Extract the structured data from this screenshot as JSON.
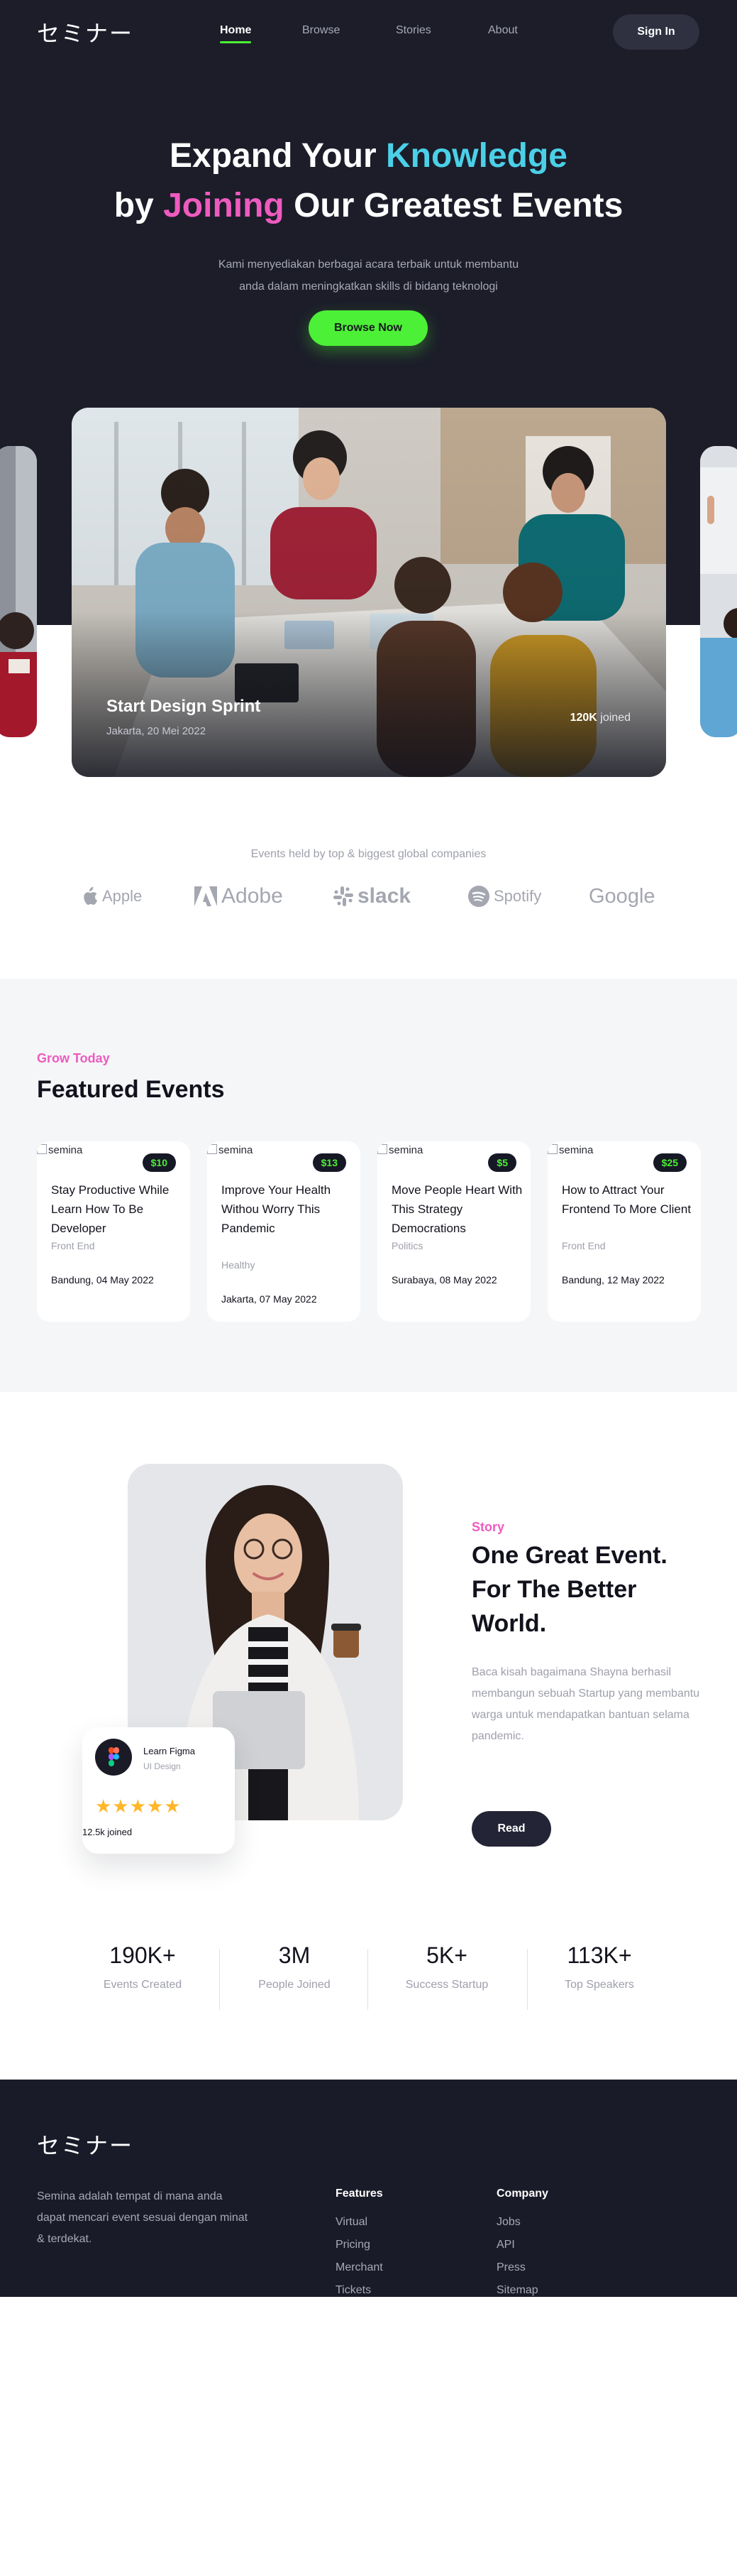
{
  "nav": {
    "logo": "セミナー",
    "links": [
      "Home",
      "Browse",
      "Stories",
      "About"
    ],
    "signin": "Sign In",
    "accent": "#4cf036"
  },
  "hero": {
    "line1_a": "Expand Your ",
    "line1_b": "Knowledge",
    "line2_a": "by ",
    "line2_b": "Joining",
    "line2_c": " Our Greatest Events",
    "sub1": "Kami menyediakan berbagai acara terbaik untuk membantu",
    "sub2": "anda dalam meningkatkan skills di bidang teknologi",
    "cta": "Browse Now",
    "card_title": "Start Design Sprint",
    "card_date": "Jakarta, 20 Mei 2022",
    "card_joined_num": "120K",
    "card_joined_word": " joined"
  },
  "companies": {
    "label": "Events held by top & biggest global companies",
    "names": [
      "Apple",
      "Adobe",
      "slack",
      "Spotify",
      "Google"
    ]
  },
  "featured": {
    "eyebrow": "Grow Today",
    "title": "Featured Events",
    "img_alt": "semina",
    "events": [
      {
        "price": "$10",
        "title": "Stay Productive While Learn How To Be Developer",
        "category": "Front End",
        "date": "Bandung, 04 May 2022"
      },
      {
        "price": "$13",
        "title": "Improve Your Health Withou Worry This Pandemic",
        "category": "Healthy",
        "date": "Jakarta, 07 May 2022"
      },
      {
        "price": "$5",
        "title": "Move People Heart With This Strategy Democrations",
        "category": "Politics",
        "date": "Surabaya, 08 May 2022"
      },
      {
        "price": "$25",
        "title": "How to Attract Your Frontend To More Client",
        "category": "Front End",
        "date": "Bandung, 12 May 2022"
      }
    ]
  },
  "story": {
    "mini_name": "Learn Figma",
    "mini_role": "UI Design",
    "mini_stars": "★★★★★",
    "mini_joined": "12.5k joined",
    "eyebrow": "Story",
    "title": "One Great Event. For The Better World.",
    "body": "Baca kisah bagaimana Shayna berhasil membangun sebuah Startup yang membantu warga untuk mendapatkan bantuan selama pandemic.",
    "cta": "Read"
  },
  "stats": [
    {
      "value": "190K+",
      "label": "Events Created"
    },
    {
      "value": "3M",
      "label": "People Joined"
    },
    {
      "value": "5K+",
      "label": "Success Startup"
    },
    {
      "value": "113K+",
      "label": "Top Speakers"
    }
  ],
  "footer": {
    "logo": "セミナー",
    "about": "Semina adalah tempat di mana anda dapat mencari event sesuai dengan minat & terdekat.",
    "features_title": "Features",
    "features": [
      "Virtual",
      "Pricing",
      "Merchant",
      "Tickets"
    ],
    "company_title": "Company",
    "company": [
      "Jobs",
      "API",
      "Press",
      "Sitemap"
    ]
  }
}
